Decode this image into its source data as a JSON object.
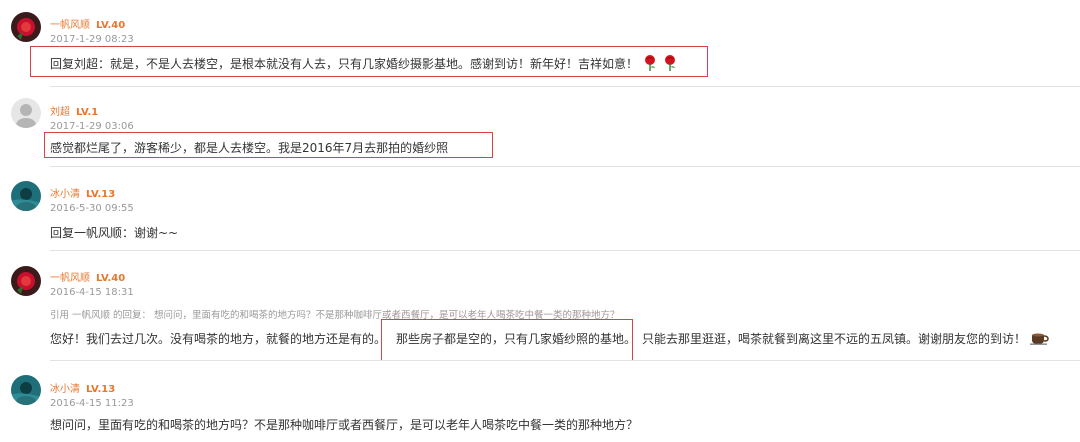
{
  "comments": [
    {
      "user": "一帆风顺",
      "level": "LV.40",
      "time": "2017-1-29 08:23",
      "text": "回复刘超：就是，不是人去楼空，是根本就没有人去，只有几家婚纱摄影基地。感谢到访！新年好！吉祥如意！",
      "emoji_icons": [
        "rose-icon",
        "rose-icon"
      ],
      "avatar_icon": "red-rose-avatar"
    },
    {
      "user": "刘超",
      "level": "LV.1",
      "time": "2017-1-29 03:06",
      "text": "感觉都烂尾了，游客稀少，都是人去楼空。我是2016年7月去那拍的婚纱照",
      "avatar_icon": "default-gray-avatar"
    },
    {
      "user": "冰小清",
      "level": "LV.13",
      "time": "2016-5-30 09:55",
      "text": "回复一帆风顺：谢谢~~",
      "avatar_icon": "teal-photo-avatar"
    },
    {
      "user": "一帆风顺",
      "level": "LV.40",
      "time": "2016-4-15 18:31",
      "quote": "引用 一帆风顺 的回复： 想问问，里面有吃的和喝茶的地方吗？不是那种咖啡厅或者西餐厅，是可以老年人喝茶吃中餐一类的那种地方？",
      "text_a": "您好！我们去过几次。没有喝茶的地方，就餐的地方还是有的。",
      "text_b": "那些房子都是空的，只有几家婚纱照的基地。",
      "text_c": "只能去那里逛逛，喝茶就餐到离这里不远的五凤镇。谢谢朋友您的到访！",
      "emoji_icons": [
        "coffee-icon"
      ],
      "avatar_icon": "red-rose-avatar"
    },
    {
      "user": "冰小清",
      "level": "LV.13",
      "time": "2016-4-15 11:23",
      "text": "想问问，里面有吃的和喝茶的地方吗？不是那种咖啡厅或者西餐厅，是可以老年人喝茶吃中餐一类的那种地方？",
      "avatar_icon": "teal-photo-avatar"
    }
  ],
  "colors": {
    "username": "#e8772e",
    "highlight_box": "#d9424a",
    "divider": "#e3e3e3"
  }
}
